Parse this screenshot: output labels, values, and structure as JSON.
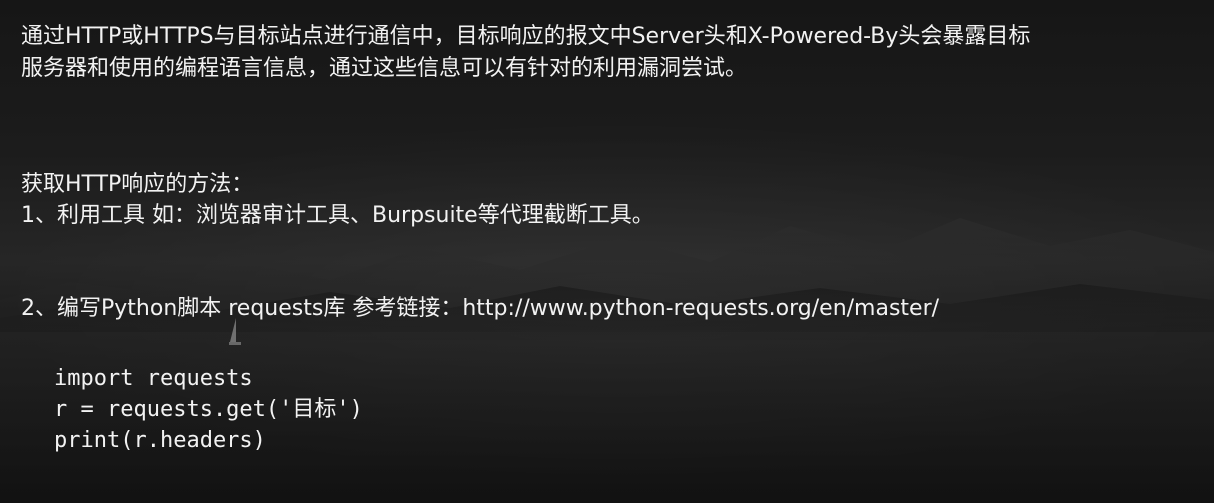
{
  "slide": {
    "intro_line_1": "通过HTTP或HTTPS与目标站点进行通信中，目标响应的报文中Server头和X-Powered-By头会暴露目标",
    "intro_line_2": "服务器和使用的编程语言信息，通过这些信息可以有针对的利用漏洞尝试。",
    "methods_heading": "获取HTTP响应的方法：",
    "method_1": "1、利用工具 如：浏览器审计工具、Burpsuite等代理截断工具。",
    "method_2": "2、编写Python脚本   requests库  参考链接：http://www.python-requests.org/en/master/",
    "code_lines": [
      "import requests",
      "r = requests.get('目标')",
      "print(r.headers)"
    ]
  }
}
